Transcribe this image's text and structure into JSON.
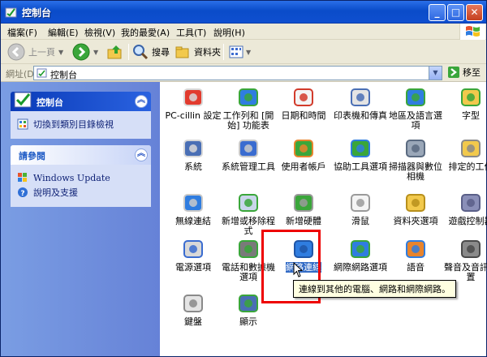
{
  "window": {
    "title": "控制台"
  },
  "menu": [
    "檔案(F)",
    "編輯(E)",
    "檢視(V)",
    "我的最愛(A)",
    "工具(T)",
    "說明(H)"
  ],
  "toolbar": {
    "back": "上一頁",
    "search": "搜尋",
    "folders": "資料夾"
  },
  "address": {
    "label": "網址(D)",
    "value": "控制台",
    "go": "移至"
  },
  "sidebar": {
    "panel1": {
      "title": "控制台",
      "link": "切換到類別目錄檢視"
    },
    "panel2": {
      "title": "請參閱",
      "links": [
        "Windows Update",
        "說明及支援"
      ]
    }
  },
  "items": [
    {
      "label": "PC-cillin 設定",
      "icon": "pccillin-icon"
    },
    {
      "label": "工作列和 [開始] 功能表",
      "icon": "taskbar-icon"
    },
    {
      "label": "日期和時間",
      "icon": "datetime-icon"
    },
    {
      "label": "印表機和傳真",
      "icon": "printer-icon"
    },
    {
      "label": "地區及語言選項",
      "icon": "globe-icon"
    },
    {
      "label": "字型",
      "icon": "fonts-folder-icon"
    },
    {
      "label": "系統",
      "icon": "system-icon"
    },
    {
      "label": "系統管理工具",
      "icon": "admin-tools-icon"
    },
    {
      "label": "使用者帳戶",
      "icon": "users-icon"
    },
    {
      "label": "協助工具選項",
      "icon": "accessibility-icon"
    },
    {
      "label": "掃描器與數位相機",
      "icon": "scanner-icon"
    },
    {
      "label": "排定的工作",
      "icon": "scheduled-tasks-icon"
    },
    {
      "label": "無線連結",
      "icon": "wireless-icon"
    },
    {
      "label": "新增或移除程式",
      "icon": "add-remove-icon"
    },
    {
      "label": "新增硬體",
      "icon": "add-hardware-icon"
    },
    {
      "label": "滑鼠",
      "icon": "mouse-icon"
    },
    {
      "label": "資料夾選項",
      "icon": "folder-options-icon"
    },
    {
      "label": "遊戲控制器",
      "icon": "gamepad-icon"
    },
    {
      "label": "電源選項",
      "icon": "power-icon"
    },
    {
      "label": "電話和數據機選項",
      "icon": "phone-modem-icon"
    },
    {
      "label": "網路連線",
      "icon": "network-connections-icon"
    },
    {
      "label": "網際網路選項",
      "icon": "internet-options-icon"
    },
    {
      "label": "語音",
      "icon": "speech-icon"
    },
    {
      "label": "聲音及音訊裝置",
      "icon": "sound-icon"
    },
    {
      "label": "鍵盤",
      "icon": "keyboard-icon"
    },
    {
      "label": "顯示",
      "icon": "display-icon"
    }
  ],
  "tooltip": "連線到其他的電腦、網路和網際網路。",
  "colors": {
    "titlebar": "#0a4cc9",
    "selection": "#316ac5",
    "highlight_box": "#e00000"
  }
}
